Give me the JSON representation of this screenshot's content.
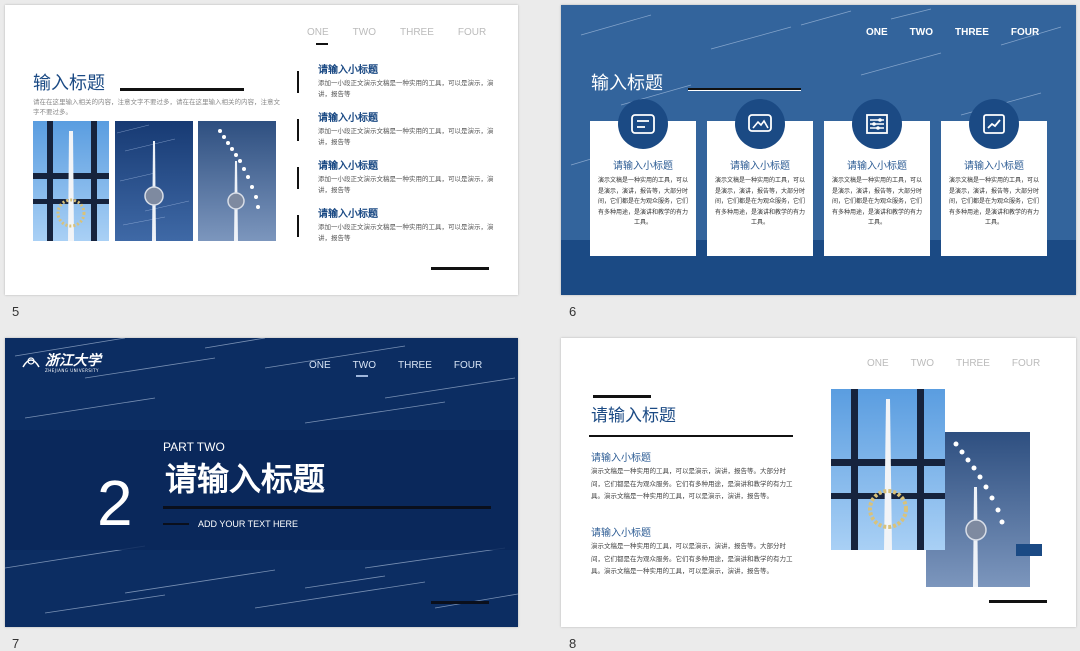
{
  "nav": [
    "ONE",
    "TWO",
    "THREE",
    "FOUR"
  ],
  "slide_numbers": [
    "5",
    "6",
    "7",
    "8"
  ],
  "slide5": {
    "title": "输入标题",
    "description": "请在在这里输入相关的内容，注意文字不要过多，请在在这里输入相关的内容，注意文字不要过多。",
    "items": [
      {
        "heading": "请输入小标题",
        "text": "添加一小段正文演示文稿是一种实用的工具，可以是演示，演讲，报告等"
      },
      {
        "heading": "请输入小标题",
        "text": "添加一小段正文演示文稿是一种实用的工具，可以是演示，演讲，报告等"
      },
      {
        "heading": "请输入小标题",
        "text": "添加一小段正文演示文稿是一种实用的工具，可以是演示，演讲，报告等"
      },
      {
        "heading": "请输入小标题",
        "text": "添加一小段正文演示文稿是一种实用的工具，可以是演示，演讲，报告等"
      }
    ]
  },
  "slide6": {
    "title": "输入标题",
    "cards": [
      {
        "icon": "list-icon",
        "heading": "请输入小标题",
        "text": "演示文稿是一种实用的工具，可以是演示，演讲，报告等，大部分时间，它们都是在为观众服务，它们有多种用途，是演讲和教学的有力工具。"
      },
      {
        "icon": "image-icon",
        "heading": "请输入小标题",
        "text": "演示文稿是一种实用的工具，可以是演示，演讲，报告等，大部分时间，它们都是在为观众服务，它们有多种用途，是演讲和教学的有力工具。"
      },
      {
        "icon": "sliders-icon",
        "heading": "请输入小标题",
        "text": "演示文稿是一种实用的工具，可以是演示，演讲，报告等，大部分时间，它们都是在为观众服务，它们有多种用途，是演讲和教学的有力工具。"
      },
      {
        "icon": "trend-chart-icon",
        "heading": "请输入小标题",
        "text": "演示文稿是一种实用的工具，可以是演示，演讲，报告等，大部分时间，它们都是在为观众服务，它们有多种用途，是演讲和教学的有力工具。"
      }
    ]
  },
  "slide7": {
    "logo_cn": "浙江大学",
    "logo_en": "ZHEJIANG UNIVERSITY",
    "number": "2",
    "part": "PART TWO",
    "title": "请输入标题",
    "subtitle": "ADD YOUR TEXT HERE"
  },
  "slide8": {
    "title": "请输入标题",
    "sections": [
      {
        "heading": "请输入小标题",
        "text": "演示文稿是一种实用的工具，可以是演示，演讲，报告等。大部分时间，它们都是在为观众服务。它们有多种用途，是演讲和教学的有力工具。演示文稿是一种实用的工具，可以是演示，演讲，报告等。"
      },
      {
        "heading": "请输入小标题",
        "text": "演示文稿是一种实用的工具，可以是演示，演讲，报告等。大部分时间，它们都是在为观众服务。它们有多种用途，是演讲和教学的有力工具。演示文稿是一种实用的工具，可以是演示，演讲，报告等。"
      }
    ]
  },
  "colors": {
    "primary": "#1b4a84",
    "slide_blue": "#2d5c94",
    "dark_navy": "#0c2d62"
  }
}
